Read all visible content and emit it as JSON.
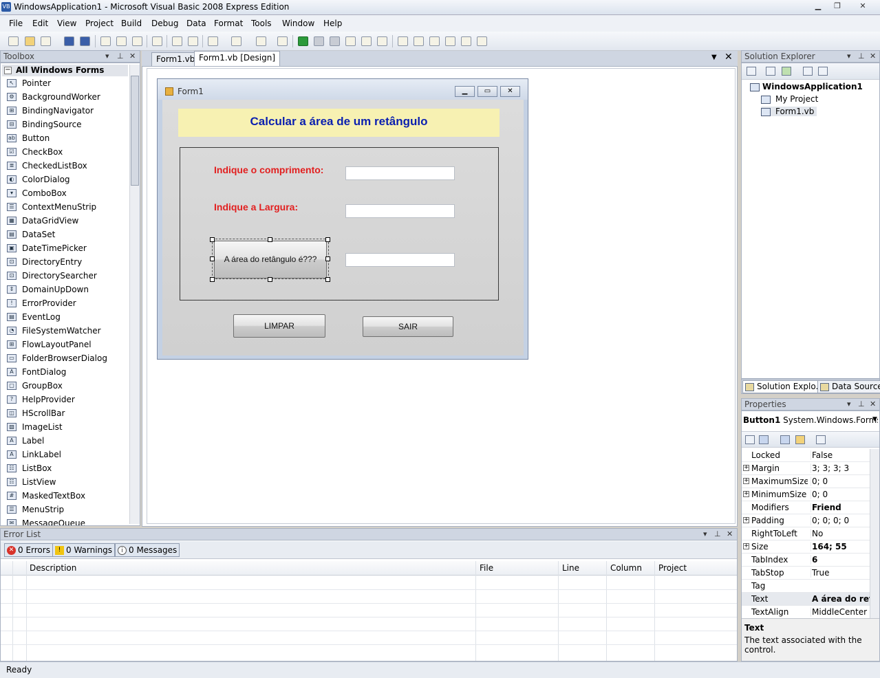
{
  "window": {
    "title": "WindowsApplication1 - Microsoft Visual Basic 2008 Express Edition",
    "app_icon_text": "VB"
  },
  "menu": [
    "File",
    "Edit",
    "View",
    "Project",
    "Build",
    "Debug",
    "Data",
    "Format",
    "Tools",
    "Window",
    "Help"
  ],
  "toolbox": {
    "title": "Toolbox",
    "group": "All Windows Forms",
    "items": [
      "Pointer",
      "BackgroundWorker",
      "BindingNavigator",
      "BindingSource",
      "Button",
      "CheckBox",
      "CheckedListBox",
      "ColorDialog",
      "ComboBox",
      "ContextMenuStrip",
      "DataGridView",
      "DataSet",
      "DateTimePicker",
      "DirectoryEntry",
      "DirectorySearcher",
      "DomainUpDown",
      "ErrorProvider",
      "EventLog",
      "FileSystemWatcher",
      "FlowLayoutPanel",
      "FolderBrowserDialog",
      "FontDialog",
      "GroupBox",
      "HelpProvider",
      "HScrollBar",
      "ImageList",
      "Label",
      "LinkLabel",
      "ListBox",
      "ListView",
      "MaskedTextBox",
      "MenuStrip",
      "MessageQueue"
    ]
  },
  "doc_tabs": [
    {
      "label": "Form1.vb",
      "active": false
    },
    {
      "label": "Form1.vb [Design]",
      "active": true
    }
  ],
  "form": {
    "title": "Form1",
    "heading": "Calcular a área de um retângulo",
    "label_length": "Indique o comprimento:",
    "label_width": "Indique a Largura:",
    "button_area": "A área do retângulo é???",
    "button_clear": "LIMPAR",
    "button_exit": "SAIR",
    "heading_color": "#0a1fb0",
    "label_color": "#e21f1f",
    "heading_bg": "#f7f1b2"
  },
  "solution_explorer": {
    "title": "Solution Explorer",
    "solution": "WindowsApplication1",
    "items": [
      "My Project",
      "Form1.vb"
    ],
    "tabs": [
      "Solution Explo...",
      "Data Sources"
    ]
  },
  "properties": {
    "title": "Properties",
    "object_name": "Button1",
    "object_type": "System.Windows.Forms.B",
    "rows": [
      {
        "name": "Locked",
        "value": "False",
        "expandable": false,
        "bold": false
      },
      {
        "name": "Margin",
        "value": "3; 3; 3; 3",
        "expandable": true,
        "bold": false
      },
      {
        "name": "MaximumSize",
        "value": "0; 0",
        "expandable": true,
        "bold": false
      },
      {
        "name": "MinimumSize",
        "value": "0; 0",
        "expandable": true,
        "bold": false
      },
      {
        "name": "Modifiers",
        "value": "Friend",
        "expandable": false,
        "bold": true
      },
      {
        "name": "Padding",
        "value": "0; 0; 0; 0",
        "expandable": true,
        "bold": false
      },
      {
        "name": "RightToLeft",
        "value": "No",
        "expandable": false,
        "bold": false
      },
      {
        "name": "Size",
        "value": "164; 55",
        "expandable": true,
        "bold": true
      },
      {
        "name": "TabIndex",
        "value": "6",
        "expandable": false,
        "bold": true
      },
      {
        "name": "TabStop",
        "value": "True",
        "expandable": false,
        "bold": false
      },
      {
        "name": "Tag",
        "value": "",
        "expandable": false,
        "bold": false
      },
      {
        "name": "Text",
        "value": "A área do retân",
        "expandable": false,
        "bold": true
      },
      {
        "name": "TextAlign",
        "value": "MiddleCenter",
        "expandable": false,
        "bold": false
      }
    ],
    "desc_title": "Text",
    "desc_text": "The text associated with the control."
  },
  "error_list": {
    "title": "Error List",
    "errors": "0 Errors",
    "warnings": "0 Warnings",
    "messages": "0 Messages",
    "columns": [
      "Description",
      "File",
      "Line",
      "Column",
      "Project"
    ]
  },
  "status": "Ready"
}
